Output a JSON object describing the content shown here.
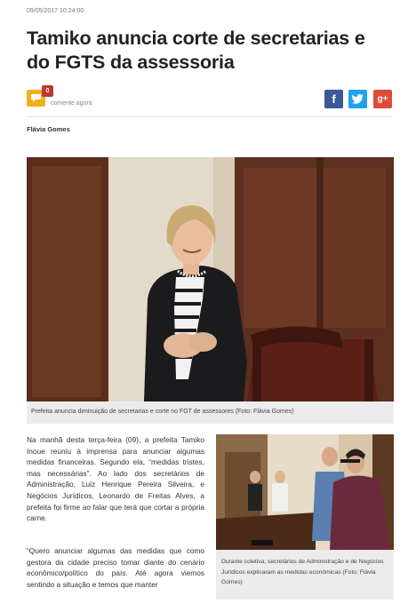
{
  "article": {
    "timestamp": "09/05/2017 10:24:00",
    "headline": "Tamiko anuncia corte de secretarias e do FGTS da assessoria",
    "author": "Flávia Gomes"
  },
  "comments": {
    "count": "0",
    "label": "comente agora"
  },
  "share": {
    "facebook": "f",
    "twitter": "twitter-bird-icon",
    "googleplus": "g+"
  },
  "hero": {
    "caption": "Prefeita anuncia diminuição de secretarias e corte no FGT de assessores (Foto: Flávia Gomes)"
  },
  "body": {
    "paragraph1": "Na manhã desta terça-feira (09), a prefeita Tamiko Inoue reuniu à imprensa para anunciar algumas medidas financeiras. Segundo ela, “medidas tristes, mas necessárias”. Ao lado dos secretários de Administração, Luiz Henrique Pereira Silveira, e Negócios Jurídicos, Leonardo de Freitas Alves, a prefeita foi firme ao falar que terá que cortar a própria carne.",
    "paragraph2": "“Quero anunciar algumas das medidas que como gestora da cidade preciso tomar diante do cenário econômico/político do país. Até agora viemos sentindo a situação e temos que manter"
  },
  "side_photo": {
    "caption": "Durante coletiva, secretários de Administração e de Negócios Jurídicos explicaram as medidas econômicas (Foto: Flávia Gomes)"
  },
  "colors": {
    "comment_accent": "#f2b01e",
    "badge": "#c0392b",
    "facebook": "#3b5998",
    "twitter": "#1da1f2",
    "googleplus": "#dd4b39"
  }
}
